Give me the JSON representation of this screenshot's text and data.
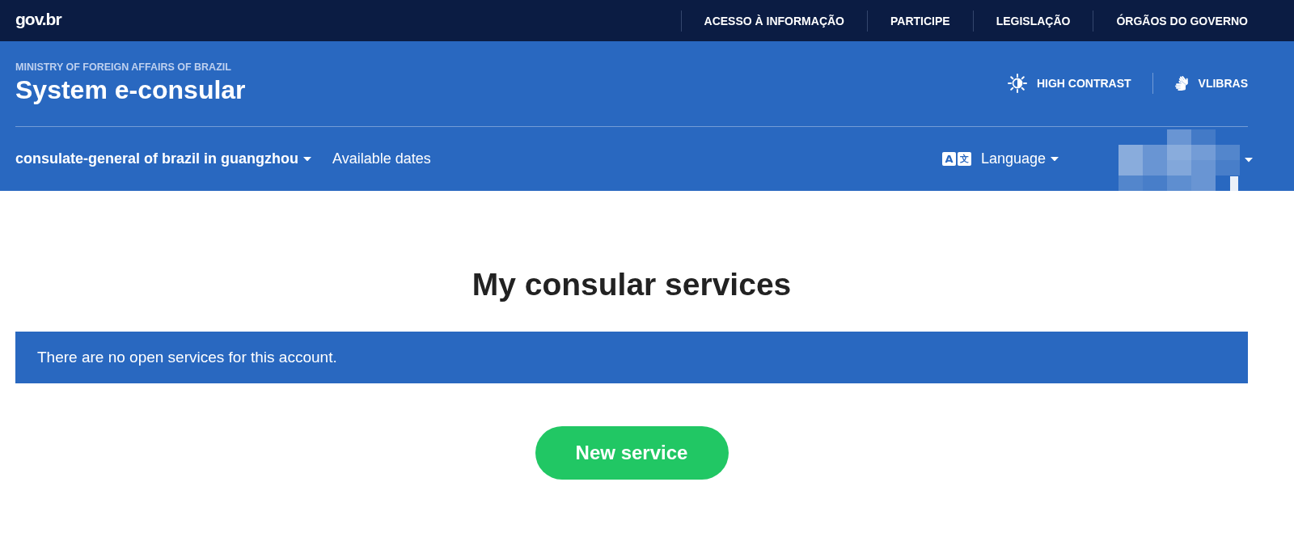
{
  "top_bar": {
    "logo": "gov.br",
    "links": [
      "ACESSO À INFORMAÇÃO",
      "PARTICIPE",
      "LEGISLAÇÃO",
      "ÓRGÃOS DO GOVERNO"
    ]
  },
  "header": {
    "ministry": "MINISTRY OF FOREIGN AFFAIRS OF BRAZIL",
    "title": "System e-consular",
    "tools": [
      {
        "kind": "contrast",
        "label": "HIGH CONTRAST"
      },
      {
        "kind": "sign_language",
        "label": "VLIBRAS"
      }
    ]
  },
  "nav": {
    "items": [
      {
        "kind": "dropdown",
        "label": "consulate-general of brazil in guangzhou"
      },
      {
        "kind": "link",
        "label": "Available dates"
      }
    ],
    "language": {
      "icon_letters": [
        "A",
        "文"
      ],
      "label": "Language"
    }
  },
  "main": {
    "heading": "My consular services",
    "alert": "There are no open services for this account.",
    "button": "New service"
  }
}
